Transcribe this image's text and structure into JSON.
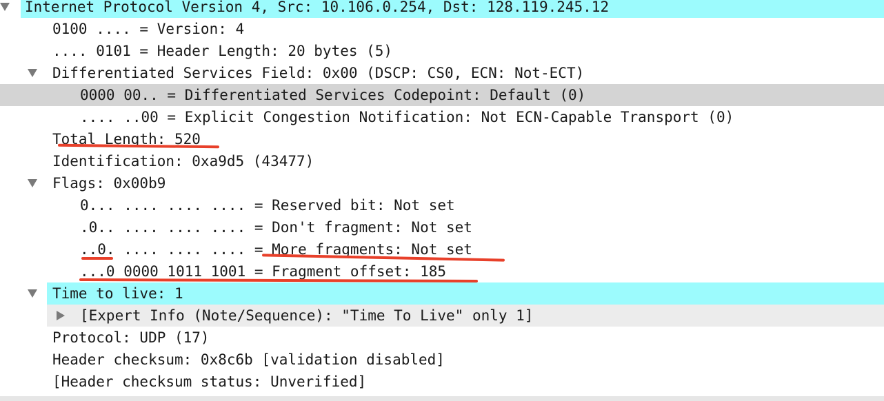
{
  "packet_details": {
    "rows": [
      {
        "text": "Internet Protocol Version 4, Src: 10.106.0.254, Dst: 128.119.245.12"
      },
      {
        "text": "0100 .... = Version: 4"
      },
      {
        "text": ".... 0101 = Header Length: 20 bytes (5)"
      },
      {
        "text": "Differentiated Services Field: 0x00 (DSCP: CS0, ECN: Not-ECT)"
      },
      {
        "text": "0000 00.. = Differentiated Services Codepoint: Default (0)"
      },
      {
        "text": ".... ..00 = Explicit Congestion Notification: Not ECN-Capable Transport (0)"
      },
      {
        "text": "Total Length: 520"
      },
      {
        "text": "Identification: 0xa9d5 (43477)"
      },
      {
        "text": "Flags: 0x00b9"
      },
      {
        "text": "0... .... .... .... = Reserved bit: Not set"
      },
      {
        "text": ".0.. .... .... .... = Don't fragment: Not set"
      },
      {
        "text": "..0. .... .... .... = More fragments: Not set"
      },
      {
        "text": "...0 0000 1011 1001 = Fragment offset: 185"
      },
      {
        "text": "Time to live: 1"
      },
      {
        "text": "[Expert Info (Note/Sequence): \"Time To Live\" only 1]"
      },
      {
        "text": "Protocol: UDP (17)"
      },
      {
        "text": "Header checksum: 0x8c6b [validation disabled]"
      },
      {
        "text": "[Header checksum status: Unverified]"
      }
    ]
  },
  "colors": {
    "selected_highlight": "#9cfbfd",
    "focused_row": "#d4d4d4",
    "annotation": "#e8402a"
  }
}
